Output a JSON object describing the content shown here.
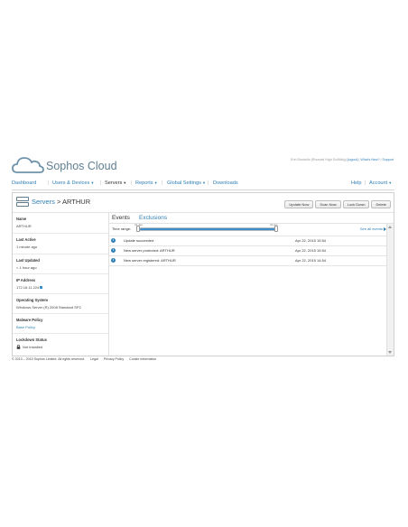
{
  "brand": {
    "name": "Sophos Cloud",
    "cloud_color": "#6f93aa"
  },
  "user_links": {
    "user": "Erin Rondello (Rhondel High Sci/Mktg)",
    "logout": "[logout]",
    "whats_new": "What's New?",
    "support": "Support"
  },
  "nav": {
    "dashboard": "Dashboard",
    "users_devices": "Users & Devices",
    "servers": "Servers",
    "reports": "Reports",
    "global_settings": "Global Settings",
    "downloads": "Downloads",
    "help": "Help",
    "account": "Account"
  },
  "breadcrumb": {
    "section": "Servers",
    "separator": ">",
    "current": "ARTHUR"
  },
  "actions": [
    "Update Now",
    "Scan Now",
    "Lock Down",
    "Delete"
  ],
  "details": [
    {
      "label": "Name",
      "value": "ARTHUR"
    },
    {
      "label": "Last Active",
      "value": "1 minute ago"
    },
    {
      "label": "Last Updated",
      "value": "< 1 hour ago"
    },
    {
      "label": "IP Address",
      "value": "172.16.11.224"
    },
    {
      "label": "Operating System",
      "value": "Windows Server (R) 2008 Standard SP2"
    },
    {
      "label": "Malware Policy",
      "value": "Base Policy"
    },
    {
      "label": "Lockdown Status",
      "value": "Not installed"
    }
  ],
  "tabs": {
    "events": "Events",
    "exclusions": "Exclusions"
  },
  "time_range": {
    "label": "Time range:",
    "start": "01 Jan",
    "end": "22 Apr",
    "see_all": "See all events"
  },
  "events": [
    {
      "message": "Update succeeded",
      "time": "Apr 22, 2015 15:54"
    },
    {
      "message": "New server protected: ARTHUR",
      "time": "Apr 22, 2015 15:54"
    },
    {
      "message": "New server registered: ARTHUR",
      "time": "Apr 22, 2015 14:54"
    }
  ],
  "footer": {
    "copyright": "© 2013 – 2015 Sophos Limited. All rights reserved.",
    "legal": "Legal",
    "privacy": "Privacy Policy",
    "cookie": "Cookie Information"
  },
  "colors": {
    "link": "#2f7fb5",
    "accent": "#3a8fd0"
  }
}
